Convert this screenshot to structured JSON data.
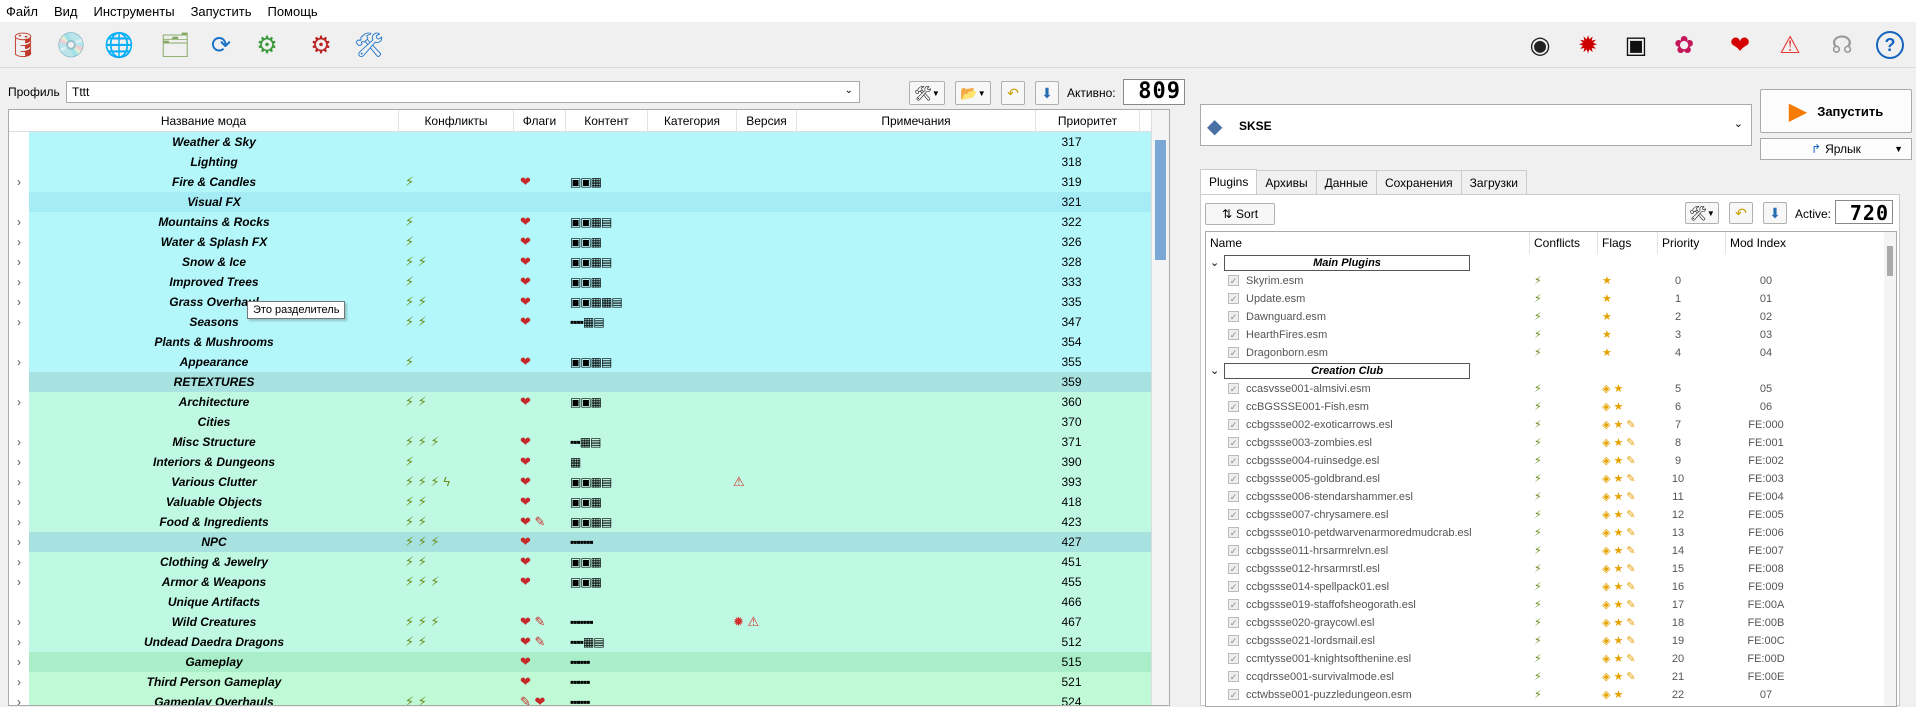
{
  "menu": [
    "Файл",
    "Вид",
    "Инструменты",
    "Запустить",
    "Помощь"
  ],
  "toolbar_left": [
    {
      "icon": "profiles-icon",
      "glyph": "🛢",
      "color": "#c0392b"
    },
    {
      "icon": "install-icon",
      "glyph": "💿",
      "color": "#666"
    },
    {
      "icon": "nexus-icon",
      "glyph": "🌐",
      "color": "#2b6cb0"
    },
    {
      "icon": "modlist-icon",
      "glyph": "🗂",
      "color": "#8a6"
    },
    {
      "icon": "refresh-icon",
      "glyph": "⟳",
      "color": "#1a73c8"
    },
    {
      "icon": "settings-icon",
      "glyph": "⚙",
      "color": "#3a9a3a"
    },
    {
      "icon": "executables-icon",
      "glyph": "⚙",
      "color": "#b22"
    },
    {
      "icon": "tools-icon",
      "glyph": "🛠",
      "color": "#2a7ac8"
    }
  ],
  "toolbar_right": [
    {
      "icon": "creation-kit-icon",
      "glyph": "◉",
      "color": "#222"
    },
    {
      "icon": "bug-icon",
      "glyph": "✹",
      "color": "#c00"
    },
    {
      "icon": "terminal-icon",
      "glyph": "▣",
      "color": "#111"
    },
    {
      "icon": "flower-icon",
      "glyph": "✿",
      "color": "#c2185b"
    },
    {
      "icon": "heart-icon",
      "glyph": "❤",
      "color": "#d50000"
    },
    {
      "icon": "warning-icon",
      "glyph": "⚠",
      "color": "#e53935"
    },
    {
      "icon": "update-icon",
      "glyph": "☊",
      "color": "#999"
    },
    {
      "icon": "help-icon",
      "glyph": "?",
      "color": "#1565c0"
    }
  ],
  "profile": {
    "label": "Профиль",
    "value": "Tttt"
  },
  "active": {
    "label": "Активно:",
    "count": "809"
  },
  "modlist": {
    "columns": [
      "Название мода",
      "Конфликты",
      "Флаги",
      "Контент",
      "Категория",
      "Версия",
      "Примечания",
      "Приоритет"
    ],
    "tooltip": "Это разделитель",
    "rows": [
      {
        "name": "Weather & Sky",
        "priority": "317",
        "bg": "#b3f7fb",
        "exp": false,
        "conf": "",
        "flags": "",
        "content": "",
        "ver": ""
      },
      {
        "name": "Lighting",
        "priority": "318",
        "bg": "#b3f7fb",
        "exp": false,
        "conf": "",
        "flags": "",
        "content": "",
        "ver": ""
      },
      {
        "name": "Fire & Candles",
        "priority": "319",
        "bg": "#b3f7fb",
        "exp": true,
        "conf": "⚡",
        "flags": "❤",
        "content": "▣▣▦",
        "ver": ""
      },
      {
        "name": "Visual FX",
        "priority": "321",
        "bg": "#a6ecf7",
        "exp": false,
        "conf": "",
        "flags": "",
        "content": "",
        "ver": ""
      },
      {
        "name": "Mountains & Rocks",
        "priority": "322",
        "bg": "#b3f7fb",
        "exp": true,
        "conf": "⚡",
        "flags": "❤",
        "content": "▣▣▦▤",
        "ver": ""
      },
      {
        "name": "Water & Splash FX",
        "priority": "326",
        "bg": "#b3f7fb",
        "exp": true,
        "conf": "⚡",
        "flags": "❤",
        "content": "▣▣▦",
        "ver": ""
      },
      {
        "name": "Snow & Ice",
        "priority": "328",
        "bg": "#b3f7fb",
        "exp": true,
        "conf": "⚡ ⚡",
        "flags": "❤",
        "content": "▣▣▦▤",
        "ver": ""
      },
      {
        "name": "Improved Trees",
        "priority": "333",
        "bg": "#b3f7fb",
        "exp": true,
        "conf": "⚡",
        "flags": "❤",
        "content": "▣▣▦",
        "ver": ""
      },
      {
        "name": "Grass Overhaul",
        "priority": "335",
        "bg": "#b3f7fb",
        "exp": true,
        "conf": "⚡ ⚡",
        "flags": "❤",
        "content": "▣▣▦▦▤",
        "ver": ""
      },
      {
        "name": "Seasons",
        "priority": "347",
        "bg": "#b3f7fb",
        "exp": true,
        "conf": "⚡ ⚡",
        "flags": "❤",
        "content": "▪▪▪▪▦▤",
        "ver": ""
      },
      {
        "name": "Plants & Mushrooms",
        "priority": "354",
        "bg": "#b3f7fb",
        "exp": false,
        "conf": "",
        "flags": "",
        "content": "",
        "ver": ""
      },
      {
        "name": "Appearance",
        "priority": "355",
        "bg": "#b3f7fb",
        "exp": true,
        "conf": "⚡",
        "flags": "❤",
        "content": "▣▣▦▤",
        "ver": ""
      },
      {
        "name": "RETEXTURES",
        "priority": "359",
        "bg": "#a8e2e0",
        "exp": false,
        "conf": "",
        "flags": "",
        "content": "",
        "ver": ""
      },
      {
        "name": "Architecture",
        "priority": "360",
        "bg": "#bff9e4",
        "exp": true,
        "conf": "⚡ ⚡",
        "flags": "❤",
        "content": "▣▣▦",
        "ver": ""
      },
      {
        "name": "Cities",
        "priority": "370",
        "bg": "#bff9e4",
        "exp": false,
        "conf": "",
        "flags": "",
        "content": "",
        "ver": ""
      },
      {
        "name": "Misc Structure",
        "priority": "371",
        "bg": "#bff9e4",
        "exp": true,
        "conf": "⚡ ⚡ ⚡",
        "flags": "❤",
        "content": "▪▪▪▦▤",
        "ver": ""
      },
      {
        "name": "Interiors & Dungeons",
        "priority": "390",
        "bg": "#bff9e4",
        "exp": true,
        "conf": "⚡",
        "flags": "❤",
        "content": "▦",
        "ver": ""
      },
      {
        "name": "Various Clutter",
        "priority": "393",
        "bg": "#bff9e4",
        "exp": true,
        "conf": "⚡ ⚡ ⚡ ϟ",
        "flags": "❤",
        "content": "▣▣▦▤",
        "ver": "⚠"
      },
      {
        "name": "Valuable Objects",
        "priority": "418",
        "bg": "#bff9e4",
        "exp": true,
        "conf": "⚡ ⚡",
        "flags": "❤",
        "content": "▣▣▦",
        "ver": ""
      },
      {
        "name": "Food & Ingredients",
        "priority": "423",
        "bg": "#bff9e4",
        "exp": true,
        "conf": "⚡ ⚡",
        "flags": "❤ ✎",
        "content": "▣▣▦▤",
        "ver": ""
      },
      {
        "name": "NPC",
        "priority": "427",
        "bg": "#a8e2e0",
        "exp": true,
        "conf": "⚡ ⚡ ⚡",
        "flags": "❤",
        "content": "▪▪▪▪▪▪▪",
        "ver": ""
      },
      {
        "name": "Clothing & Jewelry",
        "priority": "451",
        "bg": "#bff9e4",
        "exp": true,
        "conf": "⚡ ⚡",
        "flags": "❤",
        "content": "▣▣▦",
        "ver": ""
      },
      {
        "name": "Armor & Weapons",
        "priority": "455",
        "bg": "#bff9e4",
        "exp": true,
        "conf": "⚡ ⚡ ⚡",
        "flags": "❤",
        "content": "▣▣▦",
        "ver": ""
      },
      {
        "name": "Unique Artifacts",
        "priority": "466",
        "bg": "#bff9e4",
        "exp": false,
        "conf": "",
        "flags": "",
        "content": "",
        "ver": ""
      },
      {
        "name": "Wild Creatures",
        "priority": "467",
        "bg": "#bff9e4",
        "exp": true,
        "conf": "⚡ ⚡ ⚡",
        "flags": "❤ ✎",
        "content": "▪▪▪▪▪▪▪",
        "ver": "✹ ⚠"
      },
      {
        "name": "Undead Daedra Dragons",
        "priority": "512",
        "bg": "#bff9e4",
        "exp": true,
        "conf": "⚡ ⚡",
        "flags": "❤ ✎",
        "content": "▪▪▪▪▦▤",
        "ver": ""
      },
      {
        "name": "Gameplay",
        "priority": "515",
        "bg": "#a9eec8",
        "exp": true,
        "conf": "",
        "flags": "❤",
        "content": "▪▪▪▪▪▪",
        "ver": ""
      },
      {
        "name": "Third Person Gameplay",
        "priority": "521",
        "bg": "#bff9d6",
        "exp": true,
        "conf": "",
        "flags": "❤",
        "content": "▪▪▪▪▪▪",
        "ver": ""
      },
      {
        "name": "Gameplay Overhauls",
        "priority": "524",
        "bg": "#bff9d6",
        "exp": true,
        "conf": "⚡ ⚡",
        "flags": "✎ ❤",
        "content": "▪▪▪▪▪▪",
        "ver": ""
      }
    ]
  },
  "right": {
    "executable": "SKSE",
    "run_label": "Запустить",
    "shortcut_label": "Ярлык",
    "tabs": [
      "Plugins",
      "Архивы",
      "Данные",
      "Сохранения",
      "Загрузки"
    ],
    "sort_label": "Sort",
    "active_label": "Active:",
    "active_count": "720",
    "columns": [
      "Name",
      "Conflicts",
      "Flags",
      "Priority",
      "Mod Index"
    ],
    "plugins": [
      {
        "sep": true,
        "name": "Main Plugins"
      },
      {
        "name": "Skyrim.esm",
        "priority": "0",
        "index": "00",
        "f": "★"
      },
      {
        "name": "Update.esm",
        "priority": "1",
        "index": "01",
        "f": "★"
      },
      {
        "name": "Dawnguard.esm",
        "priority": "2",
        "index": "02",
        "f": "★"
      },
      {
        "name": "HearthFires.esm",
        "priority": "3",
        "index": "03",
        "f": "★"
      },
      {
        "name": "Dragonborn.esm",
        "priority": "4",
        "index": "04",
        "f": "★"
      },
      {
        "sep": true,
        "name": "Creation Club"
      },
      {
        "name": "ccasvsse001-almsivi.esm",
        "priority": "5",
        "index": "05",
        "f": "◈ ★"
      },
      {
        "name": "ccBGSSSE001-Fish.esm",
        "priority": "6",
        "index": "06",
        "f": "◈ ★"
      },
      {
        "name": "ccbgssse002-exoticarrows.esl",
        "priority": "7",
        "index": "FE:000",
        "f": "◈ ★ ✎"
      },
      {
        "name": "ccbgssse003-zombies.esl",
        "priority": "8",
        "index": "FE:001",
        "f": "◈ ★ ✎"
      },
      {
        "name": "ccbgssse004-ruinsedge.esl",
        "priority": "9",
        "index": "FE:002",
        "f": "◈ ★ ✎"
      },
      {
        "name": "ccbgssse005-goldbrand.esl",
        "priority": "10",
        "index": "FE:003",
        "f": "◈ ★ ✎"
      },
      {
        "name": "ccbgssse006-stendarshammer.esl",
        "priority": "11",
        "index": "FE:004",
        "f": "◈ ★ ✎"
      },
      {
        "name": "ccbgssse007-chrysamere.esl",
        "priority": "12",
        "index": "FE:005",
        "f": "◈ ★ ✎"
      },
      {
        "name": "ccbgssse010-petdwarvenarmoredmudcrab.esl",
        "priority": "13",
        "index": "FE:006",
        "f": "◈ ★ ✎"
      },
      {
        "name": "ccbgssse011-hrsarmrelvn.esl",
        "priority": "14",
        "index": "FE:007",
        "f": "◈ ★ ✎"
      },
      {
        "name": "ccbgssse012-hrsarmrstl.esl",
        "priority": "15",
        "index": "FE:008",
        "f": "◈ ★ ✎"
      },
      {
        "name": "ccbgssse014-spellpack01.esl",
        "priority": "16",
        "index": "FE:009",
        "f": "◈ ★ ✎"
      },
      {
        "name": "ccbgssse019-staffofsheogorath.esl",
        "priority": "17",
        "index": "FE:00A",
        "f": "◈ ★ ✎"
      },
      {
        "name": "ccbgssse020-graycowl.esl",
        "priority": "18",
        "index": "FE:00B",
        "f": "◈ ★ ✎"
      },
      {
        "name": "ccbgssse021-lordsmail.esl",
        "priority": "19",
        "index": "FE:00C",
        "f": "◈ ★ ✎"
      },
      {
        "name": "ccmtysse001-knightsofthenine.esl",
        "priority": "20",
        "index": "FE:00D",
        "f": "◈ ★ ✎"
      },
      {
        "name": "ccqdrsse001-survivalmode.esl",
        "priority": "21",
        "index": "FE:00E",
        "f": "◈ ★ ✎"
      },
      {
        "name": "cctwbsse001-puzzledungeon.esm",
        "priority": "22",
        "index": "07",
        "f": "◈ ★"
      }
    ]
  }
}
